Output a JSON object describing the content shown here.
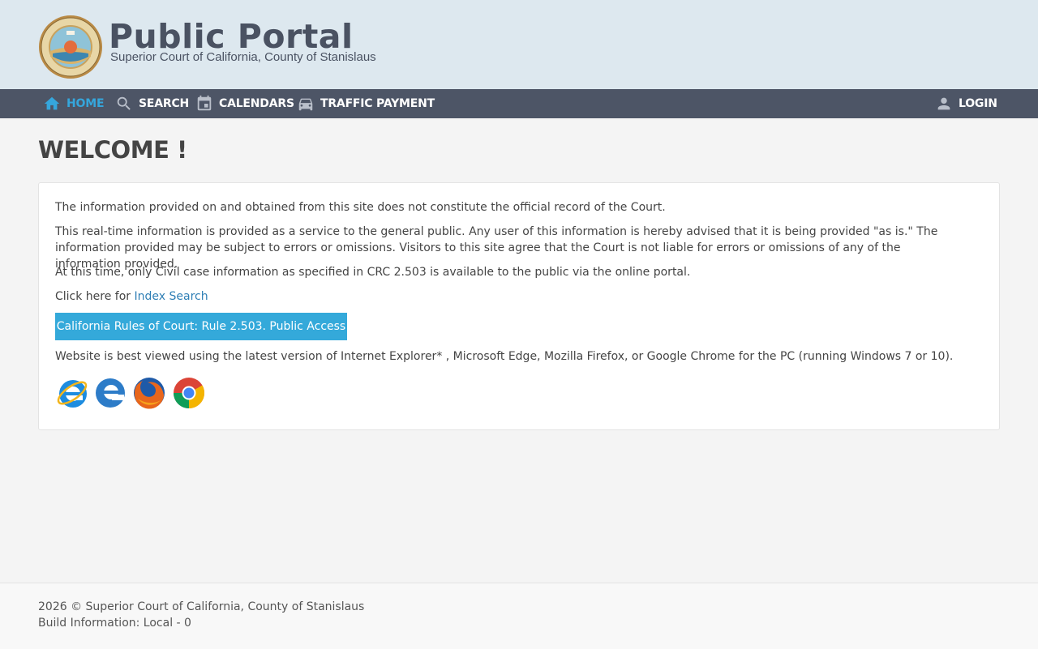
{
  "header": {
    "title": "Public Portal",
    "subtitle": "Superior Court of California, County of Stanislaus",
    "seal_alt": "Superior Court of California County of Stanislaus seal"
  },
  "nav": {
    "home": {
      "label": "HOME",
      "icon": "home-icon"
    },
    "search": {
      "label": "SEARCH",
      "icon": "search-icon"
    },
    "calendars": {
      "label": "CALENDARS",
      "icon": "calendar-icon"
    },
    "traffic": {
      "label": "TRAFFIC PAYMENT",
      "icon": "car-icon"
    },
    "login": {
      "label": "LOGIN",
      "icon": "user-icon"
    }
  },
  "main": {
    "title": "WELCOME !",
    "p1": "The information provided on and obtained from this site does not constitute the official record of the Court.",
    "p2": "This real-time information is provided as a service to the general public. Any user of this information is hereby advised that it is being provided \"as is.\" The information provided may be subject to errors or omissions. Visitors to this site agree that the Court is not liable for errors or omissions of any of the information provided.",
    "p3": "At this time, only Civil case information as specified in CRC 2.503 is available to the public via the online portal.",
    "click_prefix": "Click here for ",
    "index_link": "Index Search",
    "rules_button": "California Rules of Court: Rule 2.503. Public Access",
    "p6": "Website is best viewed using the latest version of Internet Explorer* , Microsoft Edge, Mozilla Firefox, or Google Chrome for the PC (running Windows 7 or 10).",
    "browsers": [
      "internet-explorer-icon",
      "edge-icon",
      "firefox-icon",
      "chrome-icon"
    ]
  },
  "footer": {
    "copyright": "2026 © Superior Court of California, County of Stanislaus",
    "build": "Build Information: Local - 0"
  },
  "colors": {
    "header_bg": "#dde8ef",
    "nav_bg": "#4d5566",
    "accent": "#35a6dc",
    "link": "#2f7fb5"
  }
}
